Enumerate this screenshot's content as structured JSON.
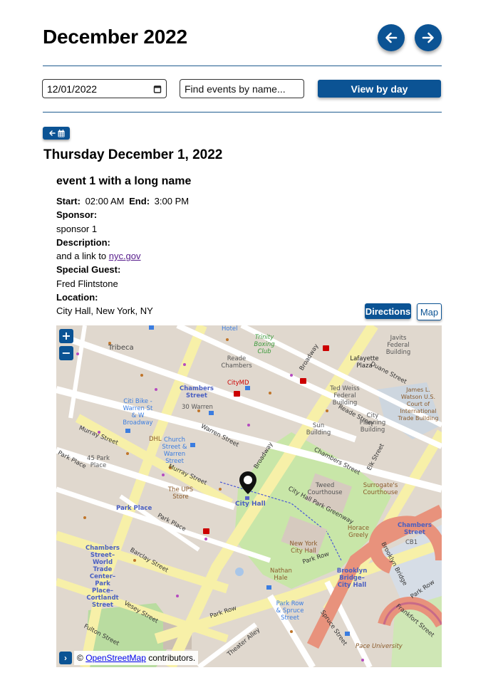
{
  "header": {
    "title": "December 2022",
    "prev_icon": "arrow-left-icon",
    "next_icon": "arrow-right-icon"
  },
  "filters": {
    "date_value": "12/01/2022",
    "date_icon": "calendar-icon",
    "search_placeholder": "Find events by name...",
    "search_value": "",
    "view_by_day_label": "View by day"
  },
  "back_to_calendar": {
    "icons": [
      "arrow-left-icon",
      "calendar-icon"
    ]
  },
  "day": {
    "title": "Thursday December 1, 2022"
  },
  "event": {
    "title": "event 1 with a long name",
    "start_label": "Start:",
    "start_value": "02:00 AM",
    "end_label": "End:",
    "end_value": "3:00 PM",
    "sponsor_label": "Sponsor:",
    "sponsor_value": "sponsor 1",
    "description_label": "Description:",
    "description_text": "and a link to ",
    "description_link": "nyc.gov",
    "guest_label": "Special Guest:",
    "guest_value": "Fred Flintstone",
    "location_label": "Location:",
    "location_value": "City Hall, New York, NY",
    "directions_label": "Directions",
    "map_label": "Map"
  },
  "map": {
    "zoom_in": "+",
    "zoom_out": "−",
    "attribution_toggle": "›",
    "attribution_prefix": "© ",
    "attribution_link": "OpenStreetMap",
    "attribution_suffix": " contributors.",
    "marker_label": "City Hall",
    "labels": {
      "tribeca": "Tribeca",
      "hotel": "Hotel",
      "trinity": "Trinity Boxing Club",
      "javits": "Javits Federal Building",
      "lafayette": "Lafayette Plaza",
      "duane": "Duane Street",
      "ted_weiss": "Ted Weiss Federal Building",
      "james": "James L. Watson U.S. Court of International Trade Building",
      "reade_chambers": "Reade Chambers",
      "citymd": "CityMD",
      "chambers_st_top": "Chambers Street",
      "warren30": "30 Warren",
      "citibike_warren": "Citi Bike - Warren St & W Broadway",
      "reade_street": "Reade Street",
      "city_planning": "City Planning Building",
      "sun": "Sun Building",
      "broadway": "Broadway",
      "murray": "Murray Street",
      "dhl": "DHL",
      "church_warren": "Church Street & Warren Street",
      "warren_street": "Warren Street",
      "chambers_street": "Chambers Street",
      "elk": "Elk Street",
      "park_place_bldg": "45 Park Place",
      "park_place": "Park Place",
      "park_place_station": "Park Place",
      "ups": "The UPS Store",
      "tweed": "Tweed Courthouse",
      "surrogate": "Surrogate's Courthouse",
      "greenway": "City Hall Park Greenway",
      "horace": "Horace Greely",
      "chambers_station": "Chambers Street",
      "nyc_hall": "New York City Hall",
      "nathan": "Nathan Hale",
      "bb_city_hall": "Brooklyn Bridge–City Hall",
      "brooklyn_bridge": "Brooklyn Bridge",
      "barclay": "Barclay Street",
      "wtc_station": "Chambers Street–World Trade Center–Park Place–Cortlandt Street",
      "vesey": "Vesey Street",
      "fulton": "Fulton Street",
      "park_row": "Park Row",
      "park_row_spruce": "Park Row & Spruce Street",
      "spruce": "Spruce Street",
      "theater_alley": "Theater Alley",
      "frankfort": "Frankfort Street",
      "pace": "Pace University",
      "cb1": "CB1",
      "murray2": "Murray Street"
    }
  }
}
